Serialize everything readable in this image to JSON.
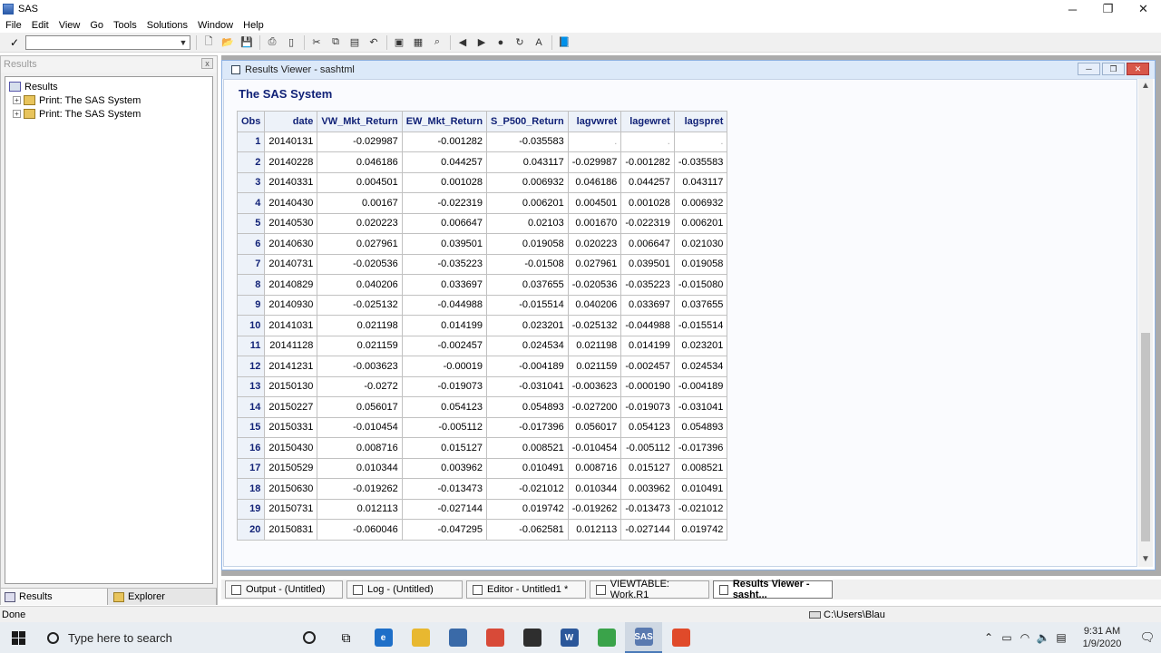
{
  "window": {
    "title": "SAS",
    "minimize": "─",
    "maximize": "❐",
    "close": "✕"
  },
  "menu": [
    "File",
    "Edit",
    "View",
    "Go",
    "Tools",
    "Solutions",
    "Window",
    "Help"
  ],
  "toolbar": {
    "command_value": ""
  },
  "results_pane": {
    "header": "Results",
    "close": "x",
    "tree": {
      "root": "Results",
      "items": [
        "Print:  The SAS System",
        "Print:  The SAS System"
      ]
    },
    "tabs": [
      "Results",
      "Explorer"
    ]
  },
  "results_viewer": {
    "title": "Results Viewer - sashtml",
    "output_title": "The SAS System",
    "table": {
      "columns": [
        "Obs",
        "date",
        "VW_Mkt_Return",
        "EW_Mkt_Return",
        "S_P500_Return",
        "lagvwret",
        "lagewret",
        "lagspret"
      ],
      "rows": [
        [
          "1",
          "20140131",
          "-0.029987",
          "-0.001282",
          "-0.035583",
          ".",
          ".",
          "."
        ],
        [
          "2",
          "20140228",
          "0.046186",
          "0.044257",
          "0.043117",
          "-0.029987",
          "-0.001282",
          "-0.035583"
        ],
        [
          "3",
          "20140331",
          "0.004501",
          "0.001028",
          "0.006932",
          "0.046186",
          "0.044257",
          "0.043117"
        ],
        [
          "4",
          "20140430",
          "0.00167",
          "-0.022319",
          "0.006201",
          "0.004501",
          "0.001028",
          "0.006932"
        ],
        [
          "5",
          "20140530",
          "0.020223",
          "0.006647",
          "0.02103",
          "0.001670",
          "-0.022319",
          "0.006201"
        ],
        [
          "6",
          "20140630",
          "0.027961",
          "0.039501",
          "0.019058",
          "0.020223",
          "0.006647",
          "0.021030"
        ],
        [
          "7",
          "20140731",
          "-0.020536",
          "-0.035223",
          "-0.01508",
          "0.027961",
          "0.039501",
          "0.019058"
        ],
        [
          "8",
          "20140829",
          "0.040206",
          "0.033697",
          "0.037655",
          "-0.020536",
          "-0.035223",
          "-0.015080"
        ],
        [
          "9",
          "20140930",
          "-0.025132",
          "-0.044988",
          "-0.015514",
          "0.040206",
          "0.033697",
          "0.037655"
        ],
        [
          "10",
          "20141031",
          "0.021198",
          "0.014199",
          "0.023201",
          "-0.025132",
          "-0.044988",
          "-0.015514"
        ],
        [
          "11",
          "20141128",
          "0.021159",
          "-0.002457",
          "0.024534",
          "0.021198",
          "0.014199",
          "0.023201"
        ],
        [
          "12",
          "20141231",
          "-0.003623",
          "-0.00019",
          "-0.004189",
          "0.021159",
          "-0.002457",
          "0.024534"
        ],
        [
          "13",
          "20150130",
          "-0.0272",
          "-0.019073",
          "-0.031041",
          "-0.003623",
          "-0.000190",
          "-0.004189"
        ],
        [
          "14",
          "20150227",
          "0.056017",
          "0.054123",
          "0.054893",
          "-0.027200",
          "-0.019073",
          "-0.031041"
        ],
        [
          "15",
          "20150331",
          "-0.010454",
          "-0.005112",
          "-0.017396",
          "0.056017",
          "0.054123",
          "0.054893"
        ],
        [
          "16",
          "20150430",
          "0.008716",
          "0.015127",
          "0.008521",
          "-0.010454",
          "-0.005112",
          "-0.017396"
        ],
        [
          "17",
          "20150529",
          "0.010344",
          "0.003962",
          "0.010491",
          "0.008716",
          "0.015127",
          "0.008521"
        ],
        [
          "18",
          "20150630",
          "-0.019262",
          "-0.013473",
          "-0.021012",
          "0.010344",
          "0.003962",
          "0.010491"
        ],
        [
          "19",
          "20150731",
          "0.012113",
          "-0.027144",
          "0.019742",
          "-0.019262",
          "-0.013473",
          "-0.021012"
        ],
        [
          "20",
          "20150831",
          "-0.060046",
          "-0.047295",
          "-0.062581",
          "0.012113",
          "-0.027144",
          "0.019742"
        ]
      ]
    }
  },
  "window_tabs": [
    "Output - (Untitled)",
    "Log - (Untitled)",
    "Editor - Untitled1 *",
    "VIEWTABLE: Work.R1",
    "Results Viewer - sasht..."
  ],
  "status": {
    "left": "Done",
    "path": "C:\\Users\\Blau"
  },
  "taskbar": {
    "search_placeholder": "Type here to search",
    "time": "9:31 AM",
    "date": "1/9/2020",
    "apps": [
      {
        "icon": "edge-icon",
        "color": "#1e6fc8",
        "glyph": "e"
      },
      {
        "icon": "file-explorer-icon",
        "color": "#e8b830",
        "glyph": ""
      },
      {
        "icon": "store-icon",
        "color": "#3a6aa8",
        "glyph": ""
      },
      {
        "icon": "chrome-icon",
        "color": "#d84a38",
        "glyph": ""
      },
      {
        "icon": "mail-icon",
        "color": "#2e2e2e",
        "glyph": ""
      },
      {
        "icon": "word-icon",
        "color": "#2b579a",
        "glyph": "W"
      },
      {
        "icon": "camtasia-icon",
        "color": "#3aa34a",
        "glyph": ""
      },
      {
        "icon": "sas-icon",
        "color": "#5a7ab0",
        "glyph": "SAS"
      },
      {
        "icon": "camtasia-recorder-icon",
        "color": "#e04a2a",
        "glyph": ""
      }
    ]
  }
}
